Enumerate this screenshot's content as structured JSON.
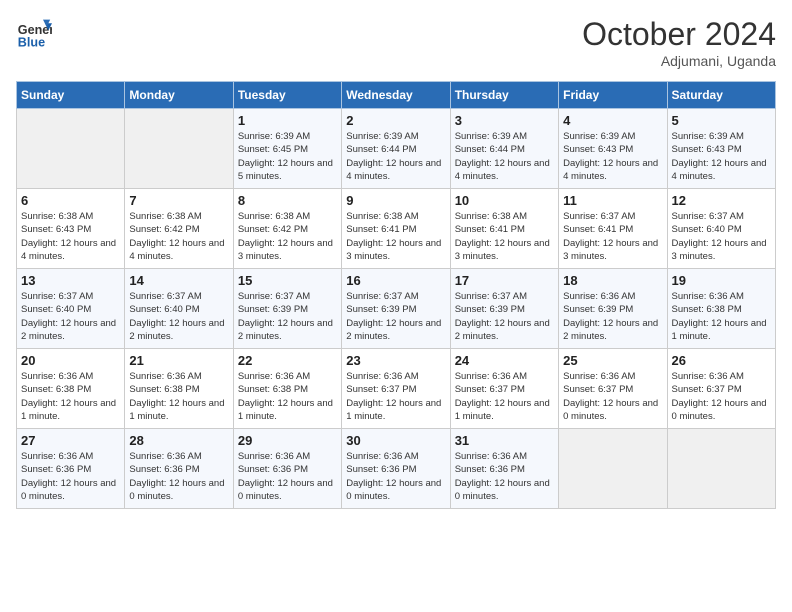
{
  "header": {
    "logo_general": "General",
    "logo_blue": "Blue",
    "month": "October 2024",
    "location": "Adjumani, Uganda"
  },
  "days_of_week": [
    "Sunday",
    "Monday",
    "Tuesday",
    "Wednesday",
    "Thursday",
    "Friday",
    "Saturday"
  ],
  "weeks": [
    [
      {
        "num": "",
        "info": ""
      },
      {
        "num": "",
        "info": ""
      },
      {
        "num": "1",
        "info": "Sunrise: 6:39 AM\nSunset: 6:45 PM\nDaylight: 12 hours and 5 minutes."
      },
      {
        "num": "2",
        "info": "Sunrise: 6:39 AM\nSunset: 6:44 PM\nDaylight: 12 hours and 4 minutes."
      },
      {
        "num": "3",
        "info": "Sunrise: 6:39 AM\nSunset: 6:44 PM\nDaylight: 12 hours and 4 minutes."
      },
      {
        "num": "4",
        "info": "Sunrise: 6:39 AM\nSunset: 6:43 PM\nDaylight: 12 hours and 4 minutes."
      },
      {
        "num": "5",
        "info": "Sunrise: 6:39 AM\nSunset: 6:43 PM\nDaylight: 12 hours and 4 minutes."
      }
    ],
    [
      {
        "num": "6",
        "info": "Sunrise: 6:38 AM\nSunset: 6:43 PM\nDaylight: 12 hours and 4 minutes."
      },
      {
        "num": "7",
        "info": "Sunrise: 6:38 AM\nSunset: 6:42 PM\nDaylight: 12 hours and 4 minutes."
      },
      {
        "num": "8",
        "info": "Sunrise: 6:38 AM\nSunset: 6:42 PM\nDaylight: 12 hours and 3 minutes."
      },
      {
        "num": "9",
        "info": "Sunrise: 6:38 AM\nSunset: 6:41 PM\nDaylight: 12 hours and 3 minutes."
      },
      {
        "num": "10",
        "info": "Sunrise: 6:38 AM\nSunset: 6:41 PM\nDaylight: 12 hours and 3 minutes."
      },
      {
        "num": "11",
        "info": "Sunrise: 6:37 AM\nSunset: 6:41 PM\nDaylight: 12 hours and 3 minutes."
      },
      {
        "num": "12",
        "info": "Sunrise: 6:37 AM\nSunset: 6:40 PM\nDaylight: 12 hours and 3 minutes."
      }
    ],
    [
      {
        "num": "13",
        "info": "Sunrise: 6:37 AM\nSunset: 6:40 PM\nDaylight: 12 hours and 2 minutes."
      },
      {
        "num": "14",
        "info": "Sunrise: 6:37 AM\nSunset: 6:40 PM\nDaylight: 12 hours and 2 minutes."
      },
      {
        "num": "15",
        "info": "Sunrise: 6:37 AM\nSunset: 6:39 PM\nDaylight: 12 hours and 2 minutes."
      },
      {
        "num": "16",
        "info": "Sunrise: 6:37 AM\nSunset: 6:39 PM\nDaylight: 12 hours and 2 minutes."
      },
      {
        "num": "17",
        "info": "Sunrise: 6:37 AM\nSunset: 6:39 PM\nDaylight: 12 hours and 2 minutes."
      },
      {
        "num": "18",
        "info": "Sunrise: 6:36 AM\nSunset: 6:39 PM\nDaylight: 12 hours and 2 minutes."
      },
      {
        "num": "19",
        "info": "Sunrise: 6:36 AM\nSunset: 6:38 PM\nDaylight: 12 hours and 1 minute."
      }
    ],
    [
      {
        "num": "20",
        "info": "Sunrise: 6:36 AM\nSunset: 6:38 PM\nDaylight: 12 hours and 1 minute."
      },
      {
        "num": "21",
        "info": "Sunrise: 6:36 AM\nSunset: 6:38 PM\nDaylight: 12 hours and 1 minute."
      },
      {
        "num": "22",
        "info": "Sunrise: 6:36 AM\nSunset: 6:38 PM\nDaylight: 12 hours and 1 minute."
      },
      {
        "num": "23",
        "info": "Sunrise: 6:36 AM\nSunset: 6:37 PM\nDaylight: 12 hours and 1 minute."
      },
      {
        "num": "24",
        "info": "Sunrise: 6:36 AM\nSunset: 6:37 PM\nDaylight: 12 hours and 1 minute."
      },
      {
        "num": "25",
        "info": "Sunrise: 6:36 AM\nSunset: 6:37 PM\nDaylight: 12 hours and 0 minutes."
      },
      {
        "num": "26",
        "info": "Sunrise: 6:36 AM\nSunset: 6:37 PM\nDaylight: 12 hours and 0 minutes."
      }
    ],
    [
      {
        "num": "27",
        "info": "Sunrise: 6:36 AM\nSunset: 6:36 PM\nDaylight: 12 hours and 0 minutes."
      },
      {
        "num": "28",
        "info": "Sunrise: 6:36 AM\nSunset: 6:36 PM\nDaylight: 12 hours and 0 minutes."
      },
      {
        "num": "29",
        "info": "Sunrise: 6:36 AM\nSunset: 6:36 PM\nDaylight: 12 hours and 0 minutes."
      },
      {
        "num": "30",
        "info": "Sunrise: 6:36 AM\nSunset: 6:36 PM\nDaylight: 12 hours and 0 minutes."
      },
      {
        "num": "31",
        "info": "Sunrise: 6:36 AM\nSunset: 6:36 PM\nDaylight: 12 hours and 0 minutes."
      },
      {
        "num": "",
        "info": ""
      },
      {
        "num": "",
        "info": ""
      }
    ]
  ]
}
